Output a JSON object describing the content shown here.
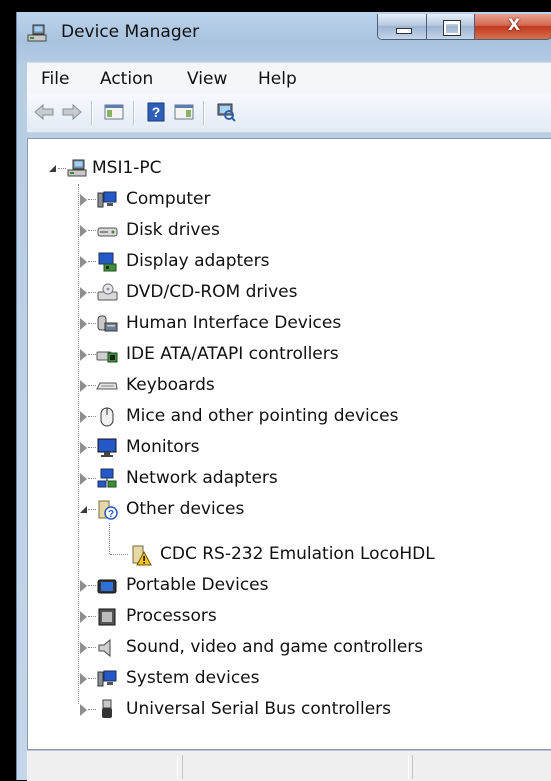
{
  "window": {
    "title": "Device Manager",
    "close_glyph": "X"
  },
  "menu": {
    "items": [
      "File",
      "Action",
      "View",
      "Help"
    ]
  },
  "toolbar": {
    "icons": [
      "back-arrow-icon",
      "forward-arrow-icon",
      "show-hide-console-tree-icon",
      "help-icon",
      "properties-icon",
      "scan-hardware-icon"
    ]
  },
  "tree": {
    "root": "MSI1-PC",
    "categories": [
      {
        "label": "Computer",
        "icon": "computer-icon"
      },
      {
        "label": "Disk drives",
        "icon": "disk-drive-icon"
      },
      {
        "label": "Display adapters",
        "icon": "display-adapter-icon"
      },
      {
        "label": "DVD/CD-ROM drives",
        "icon": "dvd-drive-icon"
      },
      {
        "label": "Human Interface Devices",
        "icon": "hid-icon"
      },
      {
        "label": "IDE ATA/ATAPI controllers",
        "icon": "ide-controller-icon"
      },
      {
        "label": "Keyboards",
        "icon": "keyboard-icon"
      },
      {
        "label": "Mice and other pointing devices",
        "icon": "mouse-icon"
      },
      {
        "label": "Monitors",
        "icon": "monitor-icon"
      },
      {
        "label": "Network adapters",
        "icon": "network-adapter-icon"
      },
      {
        "label": "Other devices",
        "icon": "unknown-device-icon",
        "expanded": true
      },
      {
        "label": "CDC RS-232 Emulation LocoHDL",
        "icon": "warning-device-icon",
        "child": true
      },
      {
        "label": "Portable Devices",
        "icon": "portable-device-icon"
      },
      {
        "label": "Processors",
        "icon": "processor-icon"
      },
      {
        "label": "Sound, video and game controllers",
        "icon": "speaker-icon"
      },
      {
        "label": "System devices",
        "icon": "system-device-icon"
      },
      {
        "label": "Universal Serial Bus controllers",
        "icon": "usb-icon"
      }
    ]
  },
  "colors": {
    "title_bar": "#b7cde4",
    "close_button": "#c0391f",
    "tree_background": "#ffffff"
  }
}
